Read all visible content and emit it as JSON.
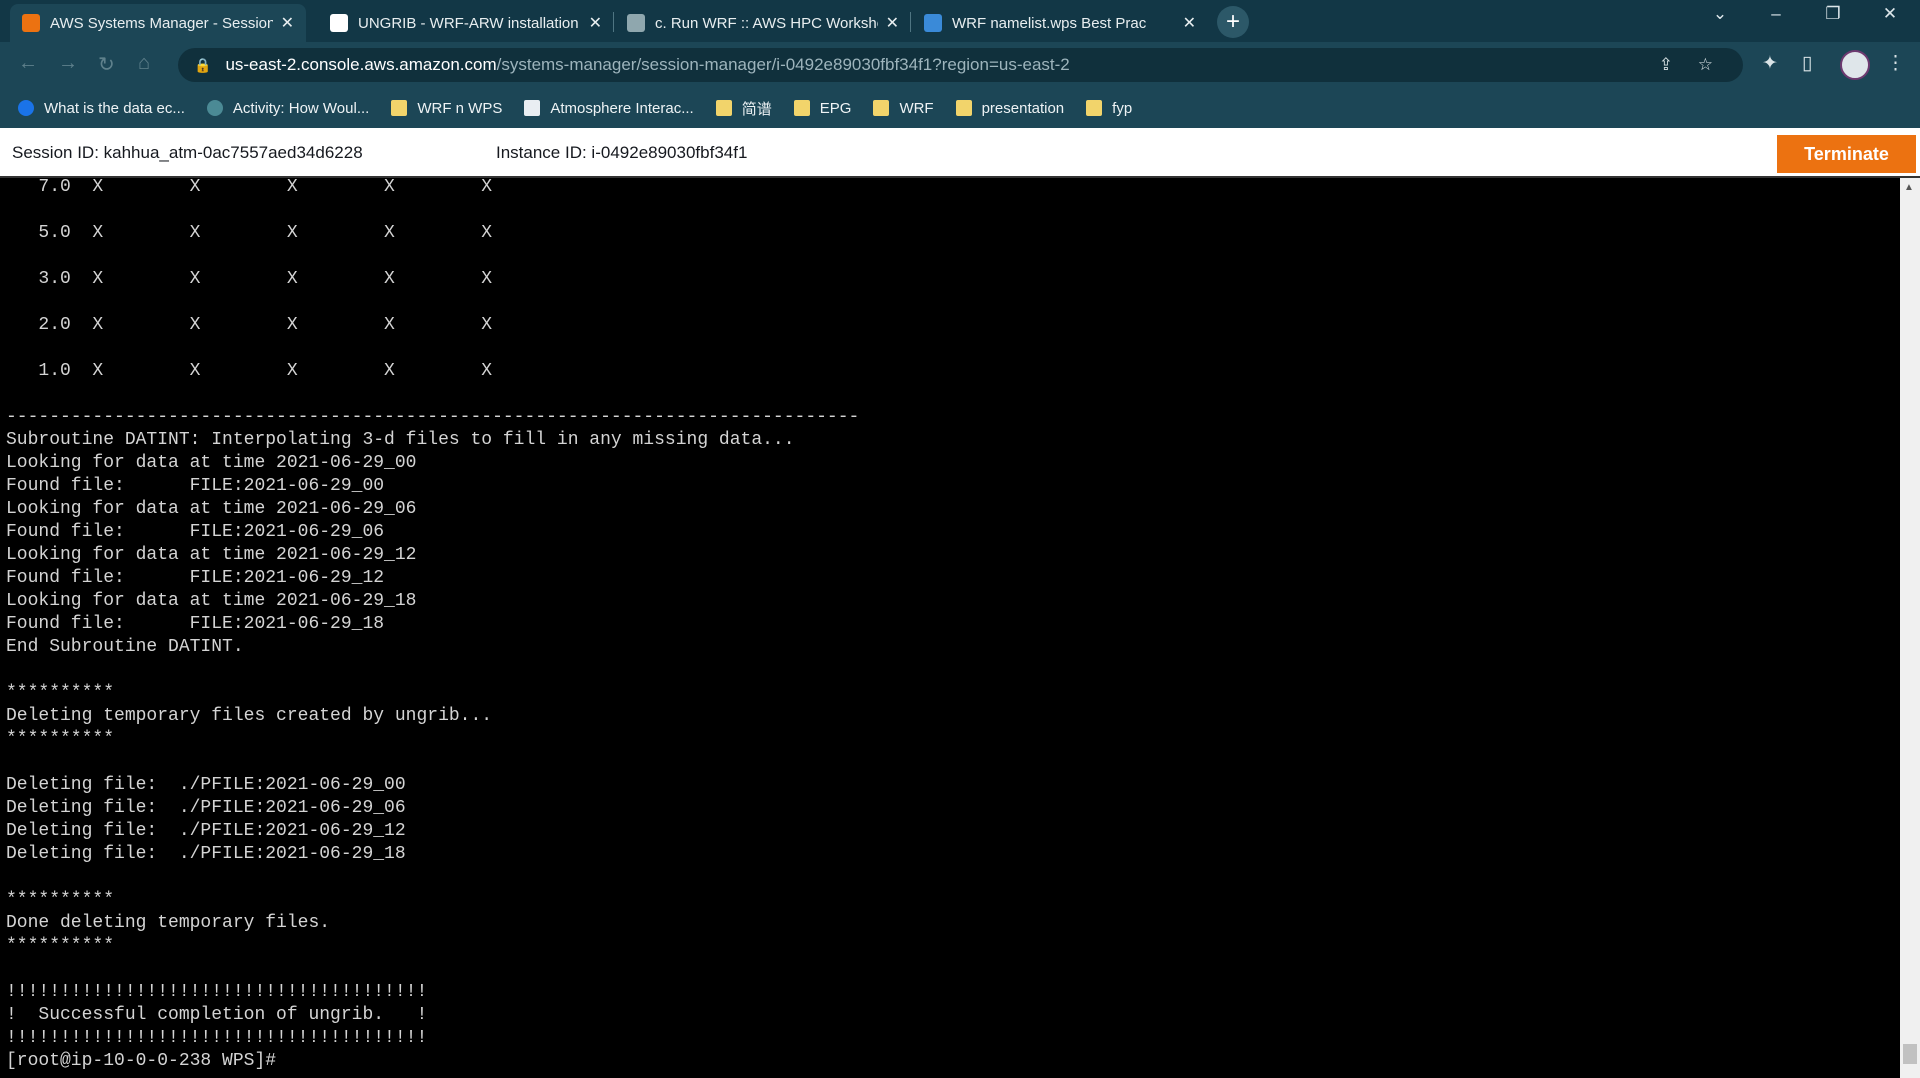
{
  "browser": {
    "tabs": [
      {
        "title": "AWS Systems Manager - Session",
        "icon": "aws-icon",
        "icon_color": "#ec7211",
        "active": true
      },
      {
        "title": "UNGRIB - WRF-ARW installation",
        "icon": "github-icon",
        "icon_color": "#ffffff",
        "active": false
      },
      {
        "title": "c. Run WRF :: AWS HPC Worksho",
        "icon": "hpc-icon",
        "icon_color": "#8fa7ae",
        "active": false
      },
      {
        "title": "WRF namelist.wps Best Prac",
        "icon": "wrf-icon",
        "icon_color": "#3a8ad8",
        "active": false
      }
    ],
    "new_tab": "+",
    "url_host": "us-east-2.console.aws.amazon.com",
    "url_path": "/systems-manager/session-manager/i-0492e89030fbf34f1?region=us-east-2",
    "bookmarks": [
      {
        "label": "What is the data ec...",
        "icon": "c-logo-icon"
      },
      {
        "label": "Activity: How Woul...",
        "icon": "globe-icon"
      },
      {
        "label": "WRF n WPS",
        "icon": "folder-icon"
      },
      {
        "label": "Atmosphere Interac...",
        "icon": "site-icon"
      },
      {
        "label": "简谱",
        "icon": "folder-icon"
      },
      {
        "label": "EPG",
        "icon": "folder-icon"
      },
      {
        "label": "WRF",
        "icon": "folder-icon"
      },
      {
        "label": "presentation",
        "icon": "folder-icon"
      },
      {
        "label": "fyp",
        "icon": "folder-icon"
      }
    ]
  },
  "session": {
    "session_id": "Session ID: kahhua_atm-0ac7557aed34d6228",
    "instance_id": "Instance ID: i-0492e89030fbf34f1",
    "terminate_label": "Terminate",
    "accent": "#ec7211"
  },
  "terminal": {
    "lines": [
      "   7.0  X        X        X        X        X",
      "",
      "   5.0  X        X        X        X        X",
      "",
      "   3.0  X        X        X        X        X",
      "",
      "   2.0  X        X        X        X        X",
      "",
      "   1.0  X        X        X        X        X",
      "",
      "-------------------------------------------------------------------------------",
      "Subroutine DATINT: Interpolating 3-d files to fill in any missing data...",
      "Looking for data at time 2021-06-29_00",
      "Found file:      FILE:2021-06-29_00",
      "Looking for data at time 2021-06-29_06",
      "Found file:      FILE:2021-06-29_06",
      "Looking for data at time 2021-06-29_12",
      "Found file:      FILE:2021-06-29_12",
      "Looking for data at time 2021-06-29_18",
      "Found file:      FILE:2021-06-29_18",
      "End Subroutine DATINT.",
      "",
      "**********",
      "Deleting temporary files created by ungrib...",
      "**********",
      "",
      "Deleting file:  ./PFILE:2021-06-29_00",
      "Deleting file:  ./PFILE:2021-06-29_06",
      "Deleting file:  ./PFILE:2021-06-29_12",
      "Deleting file:  ./PFILE:2021-06-29_18",
      "",
      "**********",
      "Done deleting temporary files.",
      "**********",
      "",
      "!!!!!!!!!!!!!!!!!!!!!!!!!!!!!!!!!!!!!!!",
      "!  Successful completion of ungrib.   !",
      "!!!!!!!!!!!!!!!!!!!!!!!!!!!!!!!!!!!!!!!",
      "[root@ip-10-0-0-238 WPS]#"
    ]
  }
}
